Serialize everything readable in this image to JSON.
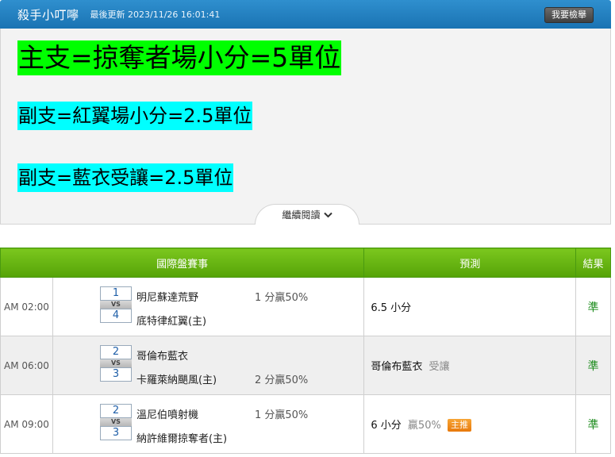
{
  "header": {
    "title": "殺手小叮嚀",
    "updated": "最後更新 2023/11/26 16:01:41",
    "report_button": "我要檢舉"
  },
  "article": {
    "main_line": "主支=掠奪者場小分=5單位",
    "sub_line_1": "副支=紅翼場小分=2.5單位",
    "sub_line_2": "副支=藍衣受讓=2.5單位",
    "read_more": "繼續閱讀"
  },
  "colors": {
    "header_blue": "#1f7fc0",
    "highlight_green": "#00ff00",
    "highlight_cyan": "#00ffff",
    "table_header_green": "#66b512",
    "result_green": "#1e8c1e",
    "badge_orange": "#f08a1c"
  },
  "table": {
    "headers": {
      "event": "國際盤賽事",
      "prediction": "預測",
      "result": "結果"
    },
    "rows": [
      {
        "time": "AM 02:00",
        "score_top": "1",
        "vs": "VS",
        "score_bottom": "4",
        "team_top": "明尼蘇達荒野",
        "team_bottom": "底特律紅翼(主)",
        "handicap_top": "1 分贏50%",
        "handicap_bottom": "",
        "prediction": "6.5 小分",
        "prediction_note": "",
        "badge": "",
        "result": "準"
      },
      {
        "time": "AM 06:00",
        "score_top": "2",
        "vs": "VS",
        "score_bottom": "3",
        "team_top": "哥倫布藍衣",
        "team_bottom": "卡羅萊納颶風(主)",
        "handicap_top": "",
        "handicap_bottom": "2 分贏50%",
        "prediction": "哥倫布藍衣",
        "prediction_note": "受讓",
        "badge": "",
        "result": "準"
      },
      {
        "time": "AM 09:00",
        "score_top": "2",
        "vs": "VS",
        "score_bottom": "3",
        "team_top": "溫尼伯噴射機",
        "team_bottom": "納許維爾掠奪者(主)",
        "handicap_top": "1 分贏50%",
        "handicap_bottom": "",
        "prediction": "6 小分",
        "prediction_note": "贏50%",
        "badge": "主推",
        "result": "準"
      }
    ]
  }
}
